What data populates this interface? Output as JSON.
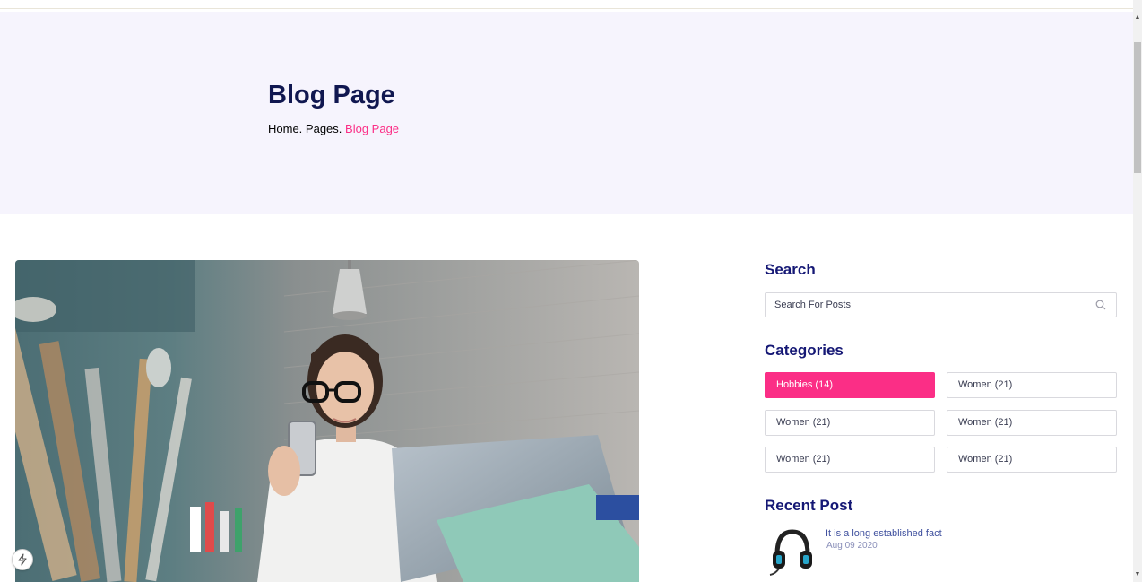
{
  "hero": {
    "title": "Blog Page",
    "breadcrumb": {
      "home": "Home.",
      "pages": "Pages.",
      "current": "Blog Page"
    }
  },
  "sidebar": {
    "search": {
      "heading": "Search",
      "placeholder": "Search For Posts"
    },
    "categories": {
      "heading": "Categories",
      "items": [
        {
          "label": "Hobbies (14)",
          "active": true
        },
        {
          "label": "Women (21)",
          "active": false
        },
        {
          "label": "Women (21)",
          "active": false
        },
        {
          "label": "Women (21)",
          "active": false
        },
        {
          "label": "Women (21)",
          "active": false
        },
        {
          "label": "Women (21)",
          "active": false
        }
      ]
    },
    "recent_post": {
      "heading": "Recent Post",
      "items": [
        {
          "title": "It is a long established fact",
          "date": "Aug 09 2020"
        }
      ]
    }
  },
  "colors": {
    "accent": "#fb2e86",
    "navy": "#151875",
    "hero_bg": "#f6f4fd"
  }
}
